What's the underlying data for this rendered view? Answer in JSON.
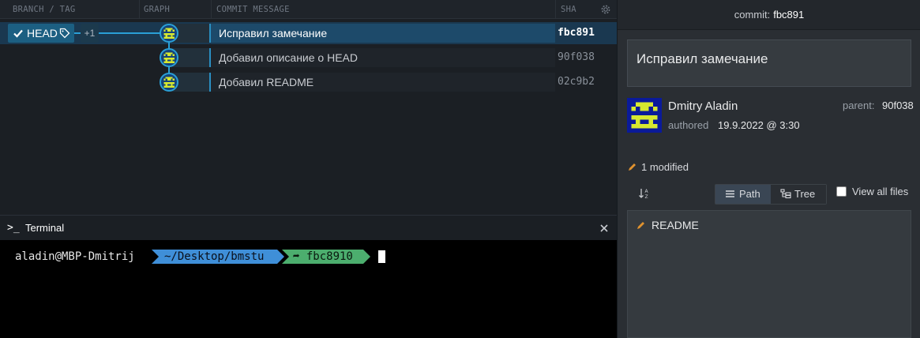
{
  "graph_header": {
    "branch_tag": "BRANCH / TAG",
    "graph": "GRAPH",
    "commit_message": "COMMIT MESSAGE",
    "sha": "SHA"
  },
  "head_tag": {
    "label": "HEAD",
    "extra": "+1"
  },
  "commits": [
    {
      "message": "Исправил замечание",
      "sha": "fbc891",
      "selected": true
    },
    {
      "message": "Добавил описание о HEAD",
      "sha": "90f038",
      "selected": false
    },
    {
      "message": "Добавил README",
      "sha": "02c9b2",
      "selected": false
    }
  ],
  "terminal": {
    "prompt_icon": ">_",
    "title": "Terminal",
    "user": "aladin@MBP-Dmitrij",
    "path": "~/Desktop/bmstu",
    "git_branch": "➦ fbc8910"
  },
  "detail": {
    "commit_label": "commit:",
    "commit_sha": "fbc891",
    "message": "Исправил замечание",
    "author": "Dmitry Aladin",
    "authored_label": "authored",
    "authored_date": "19.9.2022 @ 3:30",
    "parent_label": "parent:",
    "parent_sha": "90f038",
    "modified_count": "1 modified",
    "path_button": "Path",
    "tree_button": "Tree",
    "view_all_label": "View all files",
    "files": [
      {
        "name": "README",
        "status": "modified"
      }
    ]
  },
  "colors": {
    "accent": "#2a9fd6",
    "selected_row": "#1d4a6a",
    "terminal_path": "#3f8fd8",
    "terminal_git": "#4cae6e",
    "avatar_bg": "#0a1a9a",
    "avatar_fg": "#d6e830",
    "modified_icon": "#e0922f"
  },
  "icons": {
    "head_check": "check-icon",
    "head_tag": "tag-icon",
    "settings": "gear-icon",
    "terminal_close": "close-icon",
    "sort": "sort-az-icon",
    "path": "list-icon",
    "tree": "tree-icon",
    "modified": "pencil-icon"
  }
}
